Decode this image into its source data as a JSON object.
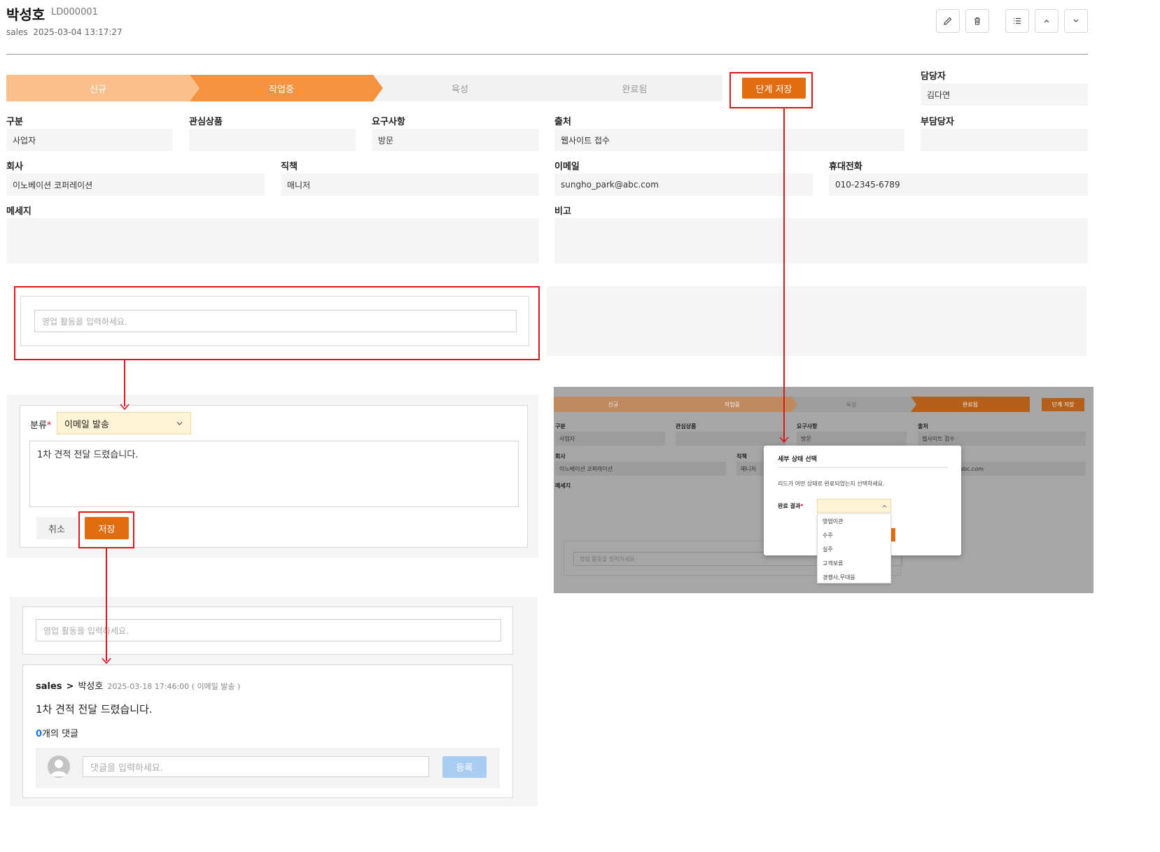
{
  "header": {
    "name": "박성호",
    "id": "LD000001",
    "meta": "sales  2025-03-04 13:17:27"
  },
  "stages": [
    "신규",
    "작업중",
    "육성",
    "완료됨"
  ],
  "stage_save_label": "단계 저장",
  "owner": {
    "label": "담당자",
    "value": "김다연"
  },
  "sub_owner": {
    "label": "부담당자",
    "value": ""
  },
  "fields": {
    "category": {
      "label": "구분",
      "value": "사업자"
    },
    "product": {
      "label": "관심상품",
      "value": ""
    },
    "request": {
      "label": "요구사항",
      "value": "방문"
    },
    "source": {
      "label": "출처",
      "value": "웹사이트 접수"
    },
    "company": {
      "label": "회사",
      "value": "이노베이션 코퍼레이션"
    },
    "position": {
      "label": "직책",
      "value": "매니저"
    },
    "email": {
      "label": "이메일",
      "value": "sungho_park@abc.com"
    },
    "mobile": {
      "label": "휴대전화",
      "value": "010-2345-6789"
    },
    "message": {
      "label": "메세지",
      "value": ""
    },
    "note": {
      "label": "비고",
      "value": ""
    }
  },
  "activity": {
    "placeholder": "영업 활동을 입력하세요."
  },
  "editor": {
    "category_label": "분류",
    "required_mark": "*",
    "category_value": "이메일 발송",
    "text": "1차 견적 전달 드렸습니다.",
    "cancel_label": "취소",
    "save_label": "저장"
  },
  "feed": {
    "placeholder": "영업 활동을 입력하세요.",
    "author": "sales",
    "separator": ">",
    "target": "박성호",
    "timestamp": "2025-03-18 17:46:00 ( 이메일 발송 )",
    "body": "1차 견적 전달 드렸습니다.",
    "comment_count": "0",
    "comment_suffix": "개의 댓글",
    "comment_placeholder": "댓글을 입력하세요.",
    "submit_label": "등록"
  },
  "modal_preview": {
    "stages": [
      "신규",
      "작업중",
      "육성",
      "완료됨"
    ],
    "stage_save_label": "단계 저장",
    "labels": {
      "category": "구분",
      "product": "관심상품",
      "request": "요구사항",
      "source": "출처",
      "company": "회사",
      "position": "직책",
      "message": "메세지"
    },
    "values": {
      "category": "사업자",
      "request": "방문",
      "source": "웹사이트 접수",
      "company": "이노베이션 코퍼레이션",
      "position": "매니저",
      "email_tail": "abc.com"
    },
    "activity_placeholder": "영업 활동을 입력하세요",
    "modal_title": "세부 상태 선택",
    "modal_desc": "리드가 어떤 상태로 완료되었는지 선택하세요.",
    "result_label": "완료 결과",
    "required_mark": "*",
    "options": [
      "영업이관",
      "수주",
      "실주",
      "고객보류",
      "경쟁사,무대응"
    ]
  },
  "colors": {
    "stage_light": "#fbbf8c",
    "stage_active": "#f5923e",
    "stage_idle": "#f2f2f2",
    "accent": "#e06d0f",
    "annotation": "#e0141e",
    "link_blue": "#1a73e8"
  }
}
